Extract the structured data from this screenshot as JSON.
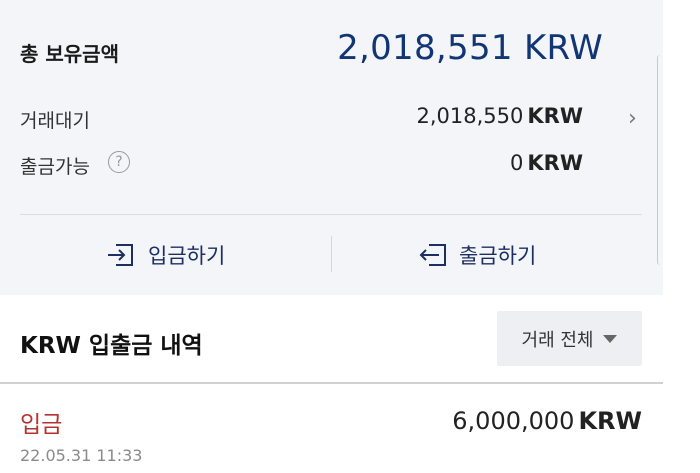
{
  "summary": {
    "total_label": "총 보유금액",
    "total_value": "2,018,551",
    "total_currency": "KRW",
    "pending_label": "거래대기",
    "pending_value": "2,018,550",
    "pending_currency": "KRW",
    "withdrawable_label": "출금가능",
    "withdrawable_value": "0",
    "withdrawable_currency": "KRW",
    "help_glyph": "?",
    "chevron_glyph": "›"
  },
  "actions": {
    "deposit_label": "입금하기",
    "withdraw_label": "출금하기"
  },
  "history": {
    "title": "KRW 입출금 내역",
    "filter_label": "거래 전체",
    "items": [
      {
        "type": "입금",
        "date": "22.05.31 11:33",
        "amount": "6,000,000",
        "currency": "KRW"
      }
    ]
  },
  "colors": {
    "accent": "#123574",
    "deposit_red": "#b8312f",
    "panel_bg": "#f4f5f8"
  }
}
